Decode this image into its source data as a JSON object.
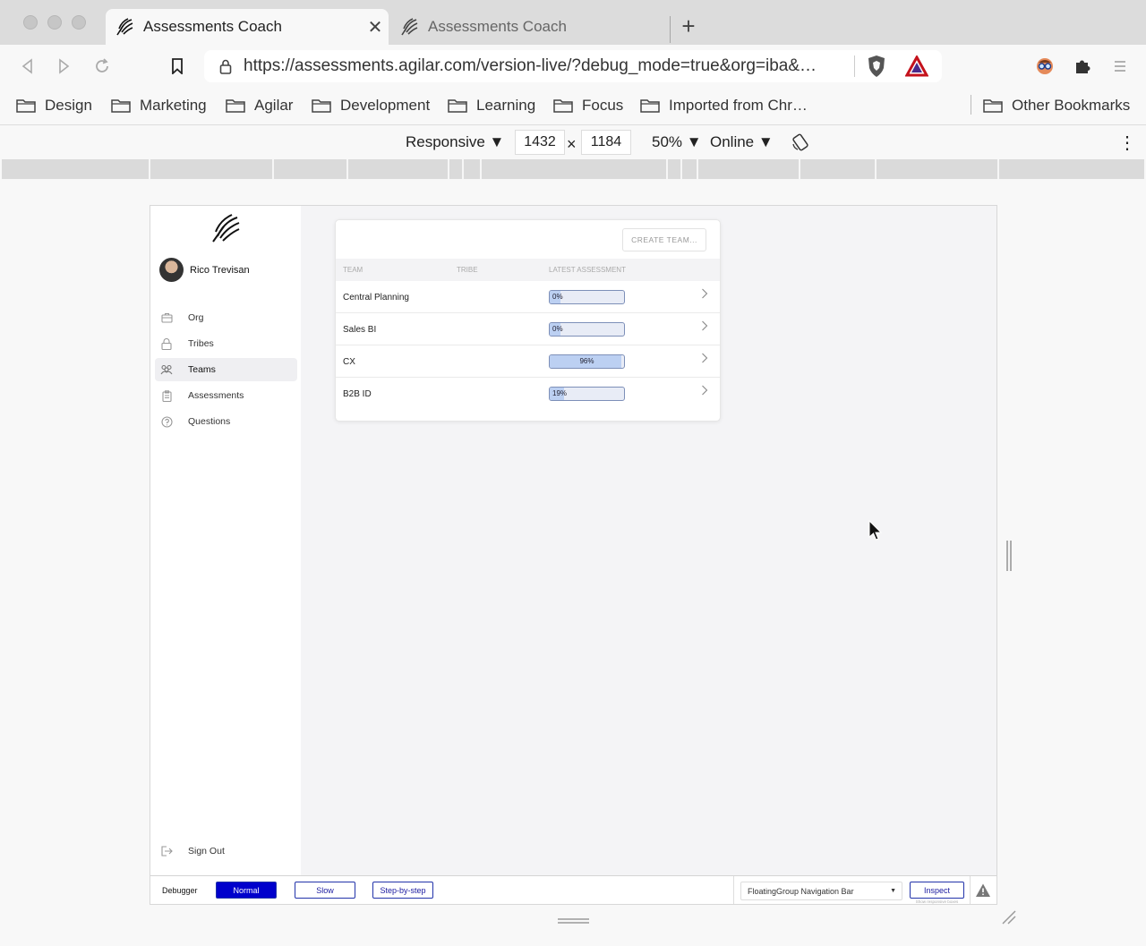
{
  "browser": {
    "tabs": [
      {
        "title": "Assessments Coach",
        "active": true,
        "close": "✕"
      },
      {
        "title": "Assessments Coach",
        "active": false
      }
    ],
    "new_tab": "+",
    "url": "https://assessments.agilar.com/version-live/?debug_mode=true&org=iba&…",
    "bookmarks": [
      "Design",
      "Marketing",
      "Agilar",
      "Development",
      "Learning",
      "Focus",
      "Imported from Chr…"
    ],
    "other_bookmarks": "Other Bookmarks"
  },
  "responsive": {
    "device": "Responsive ▼",
    "width": "1432",
    "times": "×",
    "height": "1184",
    "zoom": "50% ▼",
    "network": "Online ▼",
    "more": "⋮"
  },
  "sidebar": {
    "user_name": "Rico Trevisan",
    "items": [
      {
        "label": "Org",
        "icon": "briefcase-icon",
        "active": false
      },
      {
        "label": "Tribes",
        "icon": "lock-icon",
        "active": false
      },
      {
        "label": "Teams",
        "icon": "people-icon",
        "active": true
      },
      {
        "label": "Assessments",
        "icon": "clipboard-icon",
        "active": false
      },
      {
        "label": "Questions",
        "icon": "question-circle-icon",
        "active": false
      }
    ],
    "sign_out": "Sign Out"
  },
  "teams_card": {
    "create_button": "CREATE TEAM...",
    "columns": [
      "TEAM",
      "TRIBE",
      "LATEST ASSESSMENT"
    ],
    "rows": [
      {
        "team": "Central Planning",
        "tribe": "",
        "progress": 0.0,
        "label": "0%"
      },
      {
        "team": "Sales BI",
        "tribe": "",
        "progress": 0.0,
        "label": "0%"
      },
      {
        "team": "CX",
        "tribe": "",
        "progress": 0.96,
        "label": "96%"
      },
      {
        "team": "B2B ID",
        "tribe": "",
        "progress": 0.19,
        "label": "19%"
      }
    ]
  },
  "debugger": {
    "label": "Debugger",
    "modes": [
      {
        "label": "Normal",
        "active": true
      },
      {
        "label": "Slow",
        "active": false
      },
      {
        "label": "Step-by-step",
        "active": false
      }
    ],
    "selected_component": "FloatingGroup Navigation Bar",
    "inspect": "Inspect",
    "inspect_hint": "Show responsive boxes"
  },
  "colors": {
    "progress_fill": "#bcd0f2",
    "progress_border": "#7d8fb8",
    "debug_active": "#0000cc"
  }
}
